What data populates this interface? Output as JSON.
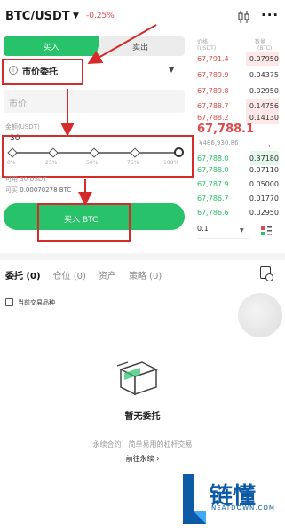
{
  "header": {
    "pair": "BTC/USDT",
    "change": "-0.25%"
  },
  "trade_tabs": {
    "buy": "买入",
    "sell": "卖出"
  },
  "order_type": {
    "label": "市价委托"
  },
  "inputs": {
    "price_placeholder": "市价",
    "amount_label": "金额(USDT)",
    "amount_value": "30"
  },
  "slider": {
    "value_percent": 100,
    "labels": [
      "0%",
      "25%",
      "50%",
      "75%",
      "100%"
    ]
  },
  "balances": {
    "available": "可用 30 USDT",
    "can_buy_label": "可买",
    "can_buy_value": "0.00070278 BTC"
  },
  "buy_button": {
    "label": "买入 BTC"
  },
  "order_book": {
    "price_header": "价格",
    "price_unit": "(USDT)",
    "qty_header": "数量",
    "qty_unit": "(BTC)",
    "asks": [
      {
        "price": "67,791.4",
        "qty": "0.07950"
      },
      {
        "price": "67,789.9",
        "qty": "0.04375"
      },
      {
        "price": "67,789.8",
        "qty": "0.02950"
      },
      {
        "price": "67,788.7",
        "qty": "0.14756"
      },
      {
        "price": "67,788.2",
        "qty": "0.14130"
      }
    ],
    "last_price": "67,788.1",
    "last_price_cny": "¥486,930.86",
    "bids": [
      {
        "price": "67,788.0",
        "qty": "0.37180"
      },
      {
        "price": "67,788.0",
        "qty": "0.07110"
      },
      {
        "price": "67,787.9",
        "qty": "0.05000"
      },
      {
        "price": "67,786.7",
        "qty": "0.01770"
      },
      {
        "price": "67,786.6",
        "qty": "0.02950"
      }
    ],
    "depth": "0.1"
  },
  "bottom_tabs": {
    "orders": "委托 (0)",
    "positions": "仓位 (0)",
    "assets": "资产",
    "strategy": "策略 (0)"
  },
  "filter": {
    "current_pair_only": "当前交易品种"
  },
  "empty_state": {
    "title": "暂无委托",
    "desc": "永续合约，简单易用的杠杆交易",
    "link": "前往永续 ›"
  },
  "watermark": {
    "text": "链懂",
    "sub": "NEATDOWN.COM"
  },
  "colors": {
    "buy_green": "#27c26a",
    "sell_red": "#e04a4a",
    "annotation_red": "#d62b2b",
    "watermark_blue": "#0d5aa7"
  }
}
